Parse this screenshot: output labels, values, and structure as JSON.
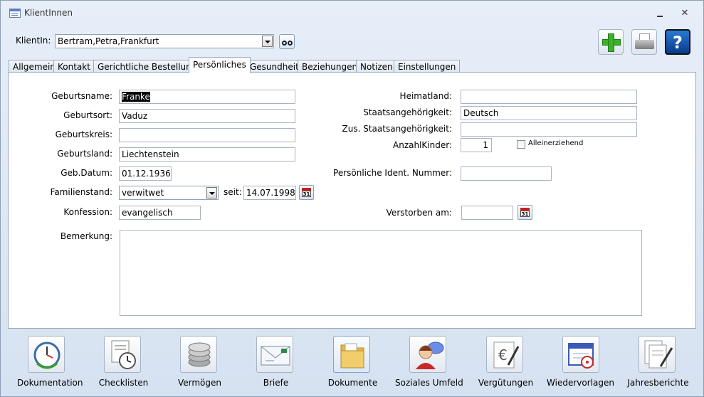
{
  "window": {
    "title": "KlientInnen"
  },
  "header": {
    "client_label": "KlientIn:",
    "client_value": "Bertram,Petra,Frankfurt",
    "tools": [
      "add-icon",
      "print-icon",
      "help-icon"
    ],
    "help_glyph": "?"
  },
  "tabs": [
    {
      "label": "Allgemein",
      "active": false
    },
    {
      "label": "Kontakt",
      "active": false
    },
    {
      "label": "Gerichtliche Bestellung",
      "active": false
    },
    {
      "label": "Persönliches",
      "active": true
    },
    {
      "label": "Gesundheit",
      "active": false
    },
    {
      "label": "Beziehungen",
      "active": false
    },
    {
      "label": "Notizen",
      "active": false
    },
    {
      "label": "Einstellungen",
      "active": false
    }
  ],
  "form": {
    "geburtsname": {
      "label": "Geburtsname:",
      "value": "Franke"
    },
    "geburtsort": {
      "label": "Geburtsort:",
      "value": "Vaduz"
    },
    "geburtskreis": {
      "label": "Geburtskreis:",
      "value": ""
    },
    "geburtsland": {
      "label": "Geburtsland:",
      "value": "Liechtenstein"
    },
    "geb_datum": {
      "label": "Geb.Datum:",
      "value": "01.12.1936"
    },
    "familienstand": {
      "label": "Familienstand:",
      "value": "verwitwet"
    },
    "seit": {
      "label": "seit:",
      "value": "14.07.1998"
    },
    "konfession": {
      "label": "Konfession:",
      "value": "evangelisch"
    },
    "bemerkung": {
      "label": "Bemerkung:",
      "value": ""
    },
    "heimatland": {
      "label": "Heimatland:",
      "value": ""
    },
    "staatsangehoerigkeit": {
      "label": "Staatsangehörigkeit:",
      "value": "Deutsch"
    },
    "zus_staatsangehoerigkeit": {
      "label": "Zus. Staatsangehörigkeit:",
      "value": ""
    },
    "anzahl_kinder": {
      "label": "AnzahlKinder:",
      "value": "1"
    },
    "alleinerziehend": {
      "label": "Alleinerziehend",
      "checked": false
    },
    "ident_nummer": {
      "label": "Persönliche Ident. Nummer:",
      "value": ""
    },
    "verstorben": {
      "label": "Verstorben am:",
      "value": ""
    },
    "calendar_glyph": "31"
  },
  "bottom_buttons": [
    {
      "label": "Dokumentation",
      "icon": "clock-document-icon"
    },
    {
      "label": "Checklisten",
      "icon": "alarm-clock-icon"
    },
    {
      "label": "Vermögen",
      "icon": "coins-icon"
    },
    {
      "label": "Briefe",
      "icon": "letter-icon"
    },
    {
      "label": "Dokumente",
      "icon": "folder-icon"
    },
    {
      "label": "Soziales Umfeld",
      "icon": "person-chat-icon"
    },
    {
      "label": "Vergütungen",
      "icon": "euro-pen-icon"
    },
    {
      "label": "Wiedervorlagen",
      "icon": "calendar-clock-icon"
    },
    {
      "label": "Jahresberichte",
      "icon": "report-pen-icon"
    }
  ]
}
